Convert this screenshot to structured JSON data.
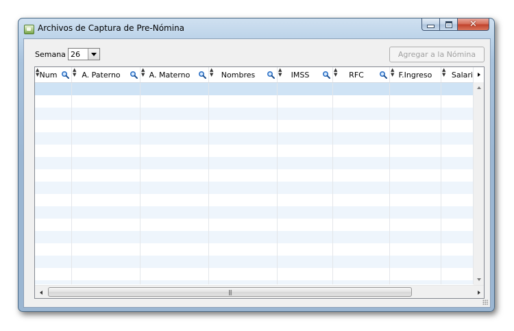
{
  "window": {
    "title": "Archivos de Captura de Pre-Nómina",
    "controls": {
      "minimize": "minimize",
      "maximize": "maximize",
      "close": "close"
    }
  },
  "toolbar": {
    "week_label": "Semana",
    "week_value": "26",
    "add_button_label": "Agregar a la Nómina"
  },
  "grid": {
    "columns": [
      {
        "label": "Num",
        "searchable": true
      },
      {
        "label": "A. Paterno",
        "searchable": true
      },
      {
        "label": "A. Materno",
        "searchable": true
      },
      {
        "label": "Nombres",
        "searchable": true
      },
      {
        "label": "IMSS",
        "searchable": true
      },
      {
        "label": "RFC",
        "searchable": true
      },
      {
        "label": "F.Ingreso",
        "searchable": false
      },
      {
        "label": "Salari",
        "searchable": false
      }
    ],
    "rows": []
  },
  "icons": {
    "sort": "sort-arrows-icon",
    "search": "magnifier-icon",
    "app": "app-icon"
  },
  "colors": {
    "selected_row": "#cfe3f5",
    "alt_row": "#eef5fc",
    "search_icon": "#2a6fc4"
  }
}
